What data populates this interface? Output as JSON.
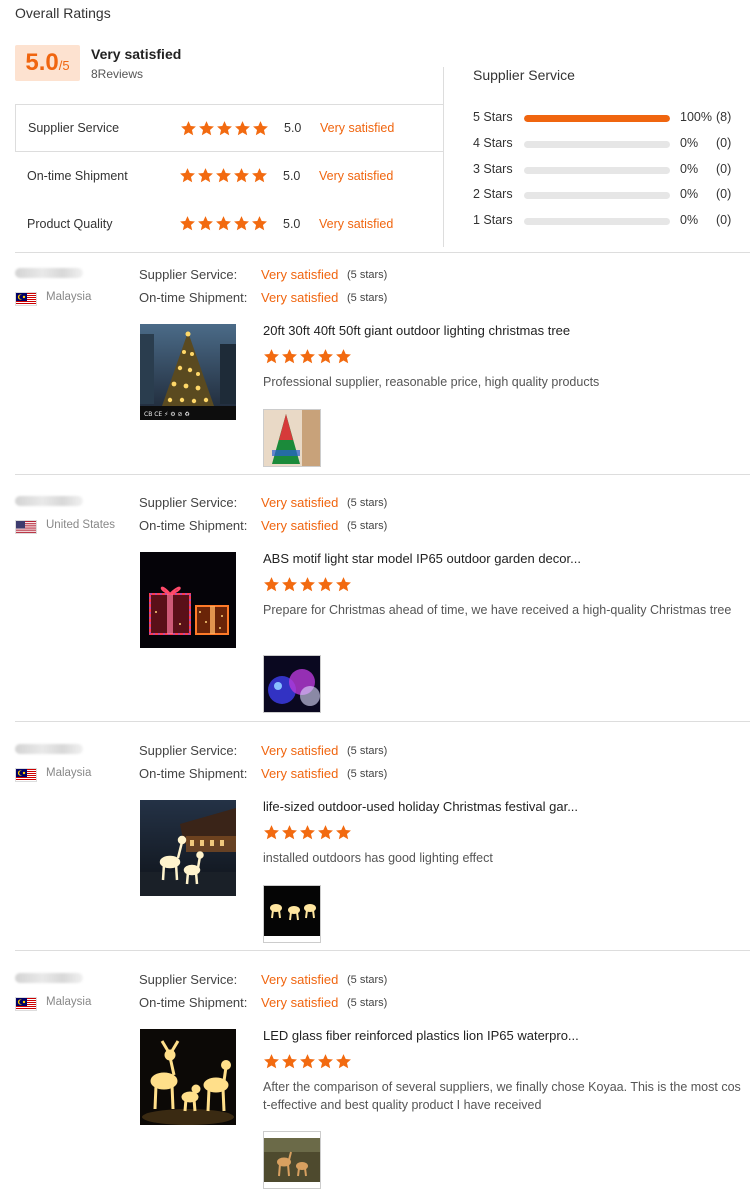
{
  "summary": {
    "title": "Overall Ratings",
    "score": "5.0",
    "score_max": "/5",
    "satisfaction": "Very satisfied",
    "reviews_count": "8Reviews",
    "categories": [
      {
        "label": "Supplier Service",
        "score": "5.0",
        "text": "Very satisfied",
        "stars": 5
      },
      {
        "label": "On-time Shipment",
        "score": "5.0",
        "text": "Very satisfied",
        "stars": 5
      },
      {
        "label": "Product Quality",
        "score": "5.0",
        "text": "Very satisfied",
        "stars": 5
      }
    ]
  },
  "distribution": {
    "title": "Supplier Service",
    "rows": [
      {
        "label": "5 Stars",
        "fraction": 1.0,
        "pct": "100%",
        "count": "(8)"
      },
      {
        "label": "4 Stars",
        "fraction": 0,
        "pct": "0%",
        "count": "(0)"
      },
      {
        "label": "3 Stars",
        "fraction": 0,
        "pct": "0%",
        "count": "(0)"
      },
      {
        "label": "2 Stars",
        "fraction": 0,
        "pct": "0%",
        "count": "(0)"
      },
      {
        "label": "1 Stars",
        "fraction": 0,
        "pct": "0%",
        "count": "(0)"
      }
    ]
  },
  "review_labels": {
    "supplier_service": "Supplier Service:",
    "ontime_shipment": "On-time Shipment:"
  },
  "reviews": [
    {
      "country": "Malaysia",
      "supplier_value": "Very satisfied",
      "supplier_stars": "(5 stars)",
      "shipment_value": "Very satisfied",
      "shipment_stars": "(5 stars)",
      "product_title": "20ft 30ft 40ft 50ft giant outdoor lighting christmas tree",
      "rating": 5,
      "comment": "Professional supplier, reasonable price, high quality products"
    },
    {
      "country": "United States",
      "supplier_value": "Very satisfied",
      "supplier_stars": "(5 stars)",
      "shipment_value": "Very satisfied",
      "shipment_stars": "(5 stars)",
      "product_title": "ABS motif light star model IP65 outdoor garden decor...",
      "rating": 5,
      "comment": "Prepare for Christmas ahead of time, we have received a high-quality Christmas tree"
    },
    {
      "country": "Malaysia",
      "supplier_value": "Very satisfied",
      "supplier_stars": "(5 stars)",
      "shipment_value": "Very satisfied",
      "shipment_stars": "(5 stars)",
      "product_title": "life-sized outdoor-used holiday Christmas festival gar...",
      "rating": 5,
      "comment": "installed outdoors has good lighting effect"
    },
    {
      "country": "Malaysia",
      "supplier_value": "Very satisfied",
      "supplier_stars": "(5 stars)",
      "shipment_value": "Very satisfied",
      "shipment_stars": "(5 stars)",
      "product_title": "LED glass fiber reinforced plastics lion IP65 waterpro...",
      "rating": 5,
      "comment": "After the comparison of several suppliers, we finally chose Koyaa. This is the most cost-effective and best quality product I have received"
    }
  ],
  "colors": {
    "accent": "#f0650f",
    "score_bg": "#fde2d0",
    "bar_bg": "#e6e6e6"
  }
}
